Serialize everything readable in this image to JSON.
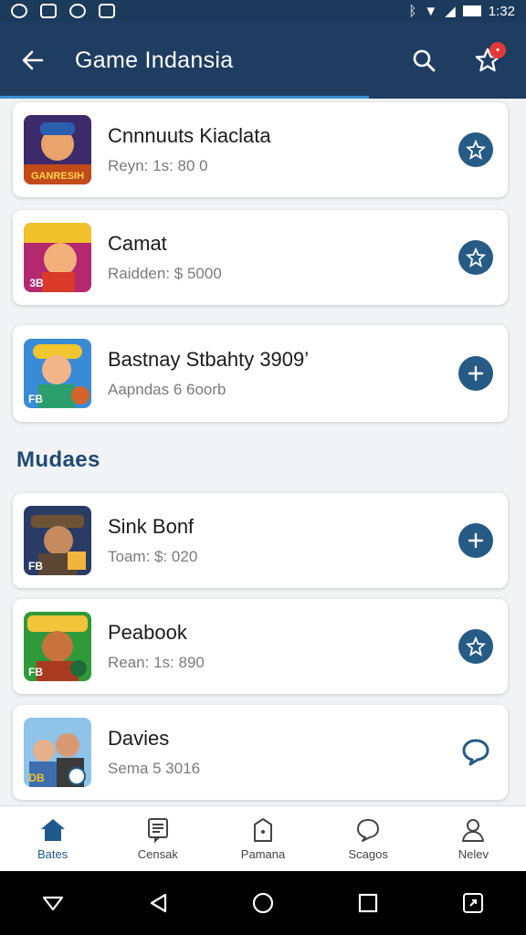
{
  "status_bar": {
    "time": "1:32"
  },
  "app_bar": {
    "title": "Game Indansia"
  },
  "colors": {
    "primary": "#1f3d61",
    "accent": "#255b85",
    "badge": "#e23a3a"
  },
  "games_top": [
    {
      "name": "Cnnnuuts Kiaclata",
      "meta": "Reyn: 1s: 80 0",
      "action_icon": "star-plus-icon"
    },
    {
      "name": "Camat",
      "meta": "Raidden: $ 5000",
      "action_icon": "star-plus-icon"
    },
    {
      "name": "Bastnay Stbahty 3909’",
      "meta": "Aapndas 6 6oorb",
      "action_icon": "plus-icon"
    }
  ],
  "section": {
    "title": "Mudaes"
  },
  "games_bottom": [
    {
      "name": "Sink Bonf",
      "meta": "Toam: $: 020",
      "action_icon": "plus-icon"
    },
    {
      "name": "Peabook",
      "meta": "Rean: 1s: 890",
      "action_icon": "star-plus-icon"
    },
    {
      "name": "Davies",
      "meta": "Sema 5 3016",
      "action_icon": "chat-icon"
    }
  ],
  "thumb_labels": [
    "GANRESIH",
    "3B",
    "FB",
    "FB",
    "FB",
    "DB"
  ],
  "bottom_nav": [
    {
      "label": "Bates",
      "icon": "home-icon",
      "active": true
    },
    {
      "label": "Censak",
      "icon": "document-icon",
      "active": false
    },
    {
      "label": "Pamana",
      "icon": "bag-icon",
      "active": false
    },
    {
      "label": "Scagos",
      "icon": "chat-icon",
      "active": false
    },
    {
      "label": "Nelev",
      "icon": "profile-icon",
      "active": false
    }
  ]
}
